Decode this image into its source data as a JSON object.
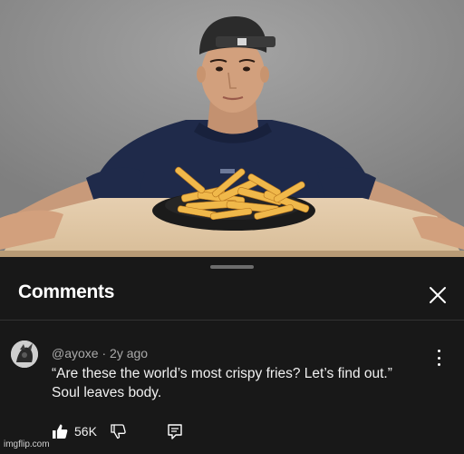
{
  "video": {
    "subject": "man with backwards cap at table with plate of french fries"
  },
  "comments_panel": {
    "title": "Comments",
    "close_icon": "close-icon"
  },
  "comment": {
    "handle": "@ayoxe",
    "separator": "·",
    "age": "2y ago",
    "lines": [
      "“Are these the world’s most crispy fries? Let’s find out.”",
      "Soul leaves body."
    ],
    "likes": "56K",
    "icons": [
      "like-icon",
      "dislike-icon",
      "reply-icon",
      "more-options-icon"
    ]
  },
  "watermark": "imgflip.com",
  "colors": {
    "background": "#181818",
    "text_primary": "#f1f1f1",
    "text_secondary": "#aaaaaa"
  }
}
